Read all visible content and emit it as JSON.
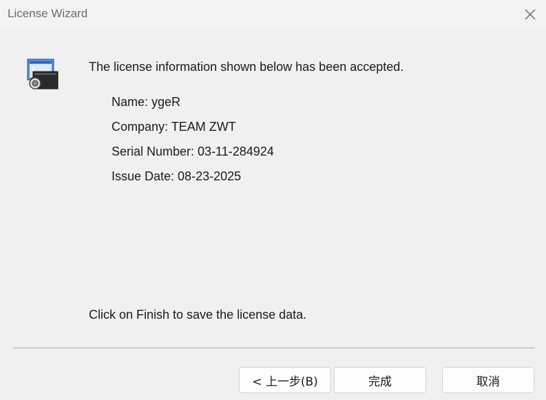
{
  "window": {
    "title": "License Wizard"
  },
  "content": {
    "headline": "The license information shown below has been accepted.",
    "name_line": "Name: ygeR",
    "company_line": "Company: TEAM ZWT",
    "serial_line": "Serial Number: 03-11-284924",
    "issue_date_line": "Issue Date: 08-23-2025",
    "finish_note": "Click on Finish to save the license data."
  },
  "buttons": {
    "back_label": "< 上一步(B)",
    "finish_label": "完成",
    "cancel_label": "取消"
  },
  "icons": {
    "close": "close-icon",
    "app": "license-wizard-app-icon"
  },
  "colors": {
    "background": "#f0f0f0",
    "titlebar": "#f3f3f3",
    "title_text": "#6b6b6b",
    "button_bg": "#fdfdfd",
    "button_border": "#d0d0d0"
  }
}
